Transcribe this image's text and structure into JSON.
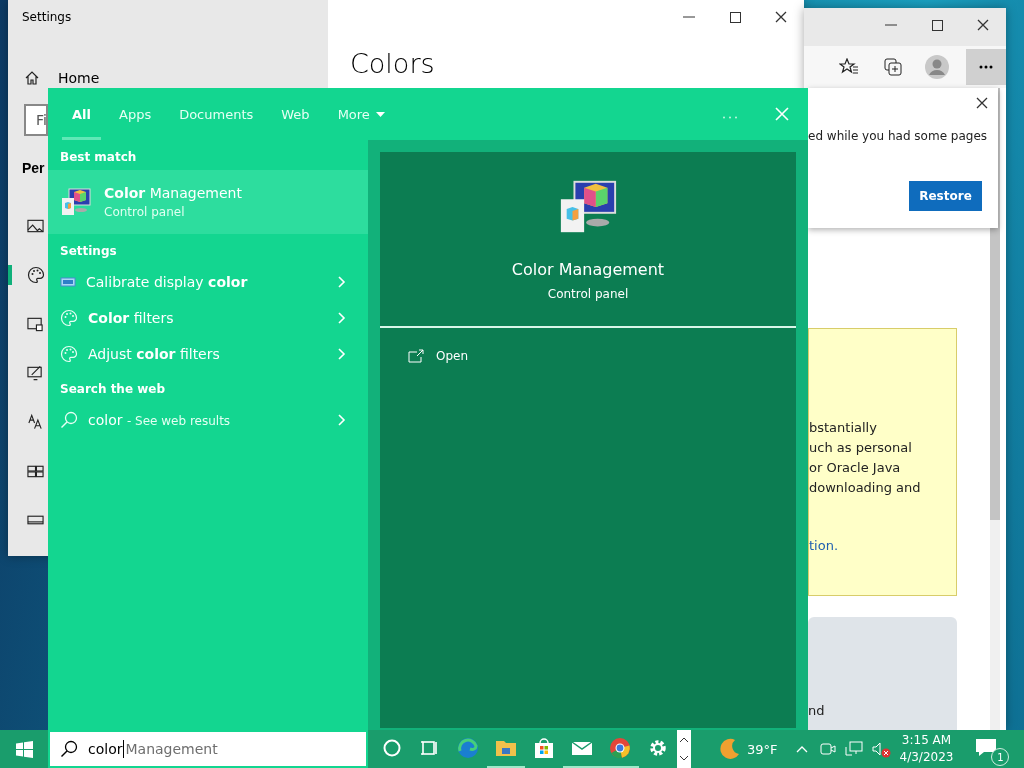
{
  "settings_window": {
    "title": "Settings",
    "home": "Home",
    "search_placeholder": "Fi",
    "section": "Per",
    "page_title": "Colors",
    "nav_items": [
      {
        "kind": "picture",
        "selected": false
      },
      {
        "kind": "palette",
        "selected": true
      },
      {
        "kind": "lockscreen",
        "selected": false
      },
      {
        "kind": "themes",
        "selected": false
      },
      {
        "kind": "fonts",
        "selected": false
      },
      {
        "kind": "start",
        "selected": false
      },
      {
        "kind": "taskbar",
        "selected": false
      }
    ]
  },
  "browser_window": {
    "notice_text": "ed while you had some pages",
    "restore_button": "Restore",
    "notice_lines": [
      "bstantially",
      "uch as personal",
      "or Oracle Java",
      "downloading and"
    ],
    "link": "tion.",
    "card_text": "nd"
  },
  "search_panel": {
    "tabs": [
      {
        "label": "All",
        "selected": true
      },
      {
        "label": "Apps",
        "selected": false
      },
      {
        "label": "Documents",
        "selected": false
      },
      {
        "label": "Web",
        "selected": false
      }
    ],
    "more_tab": "More",
    "best_match": {
      "heading": "Best match",
      "title": "**Color** Management",
      "subtitle": "Control panel",
      "selected": true
    },
    "settings": {
      "heading": "Settings",
      "items": [
        {
          "kind": "display",
          "label": "Calibrate display **color**"
        },
        {
          "kind": "palette",
          "label": "**Color** filters"
        },
        {
          "kind": "palette",
          "label": "Adjust **color** filters"
        }
      ]
    },
    "web": {
      "heading": "Search the web",
      "query": "color",
      "hint": "- See web results"
    },
    "preview": {
      "title": "Color Management",
      "subtitle": "Control panel",
      "actions": [
        {
          "label": "Open"
        }
      ]
    },
    "search_box": {
      "value": "color",
      "suggestion": "Management"
    }
  },
  "taskbar": {
    "apps": [
      {
        "kind": "cortana",
        "running": false
      },
      {
        "kind": "taskview",
        "running": false
      },
      {
        "kind": "edge",
        "running": false
      },
      {
        "kind": "explorer",
        "running": true
      },
      {
        "kind": "store",
        "running": false
      },
      {
        "kind": "mail",
        "running": true
      },
      {
        "kind": "chrome",
        "running": true
      },
      {
        "kind": "settings",
        "running": false
      }
    ],
    "weather": "39°F",
    "time": "3:15 AM",
    "date": "4/3/2023",
    "notifications": "1"
  }
}
